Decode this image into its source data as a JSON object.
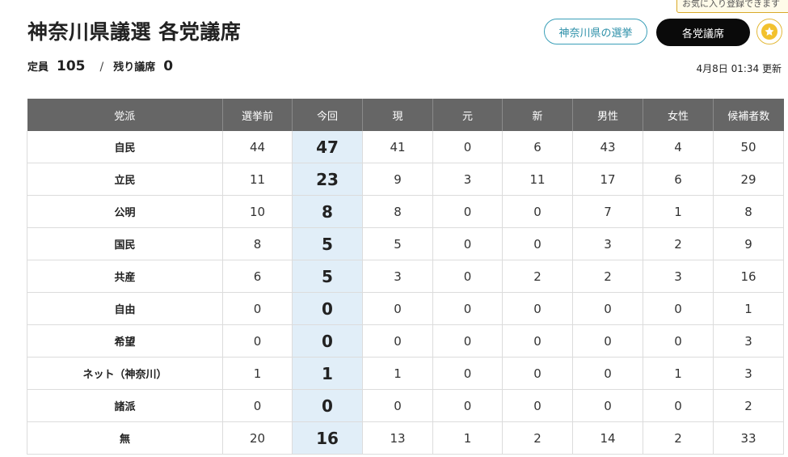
{
  "title": "神奈川県議選 各党議席",
  "summary": {
    "capacity_label": "定員",
    "capacity_value": "105",
    "separator": "/",
    "remaining_label": "残り議席",
    "remaining_value": "0"
  },
  "updated": "4月8日 01:34 更新",
  "buttons": {
    "prefecture_elections": "神奈川県の選挙",
    "party_seats": "各党議席"
  },
  "favorite_tooltip": "お気に入り登録できます",
  "colors": {
    "header_bg": "#666666",
    "current_col_bg": "#e1eef8",
    "accent_teal": "#3a9fb8",
    "star_yellow": "#f2c12e"
  },
  "icons": {
    "favorite": "star-icon"
  },
  "table": {
    "headers": [
      "党派",
      "選挙前",
      "今回",
      "現",
      "元",
      "新",
      "男性",
      "女性",
      "候補者数"
    ],
    "rows": [
      [
        "自民",
        "44",
        "47",
        "41",
        "0",
        "6",
        "43",
        "4",
        "50"
      ],
      [
        "立民",
        "11",
        "23",
        "9",
        "3",
        "11",
        "17",
        "6",
        "29"
      ],
      [
        "公明",
        "10",
        "8",
        "8",
        "0",
        "0",
        "7",
        "1",
        "8"
      ],
      [
        "国民",
        "8",
        "5",
        "5",
        "0",
        "0",
        "3",
        "2",
        "9"
      ],
      [
        "共産",
        "6",
        "5",
        "3",
        "0",
        "2",
        "2",
        "3",
        "16"
      ],
      [
        "自由",
        "0",
        "0",
        "0",
        "0",
        "0",
        "0",
        "0",
        "1"
      ],
      [
        "希望",
        "0",
        "0",
        "0",
        "0",
        "0",
        "0",
        "0",
        "3"
      ],
      [
        "ネット（神奈川）",
        "1",
        "1",
        "1",
        "0",
        "0",
        "0",
        "1",
        "3"
      ],
      [
        "諸派",
        "0",
        "0",
        "0",
        "0",
        "0",
        "0",
        "0",
        "2"
      ],
      [
        "無",
        "20",
        "16",
        "13",
        "1",
        "2",
        "14",
        "2",
        "33"
      ]
    ]
  }
}
